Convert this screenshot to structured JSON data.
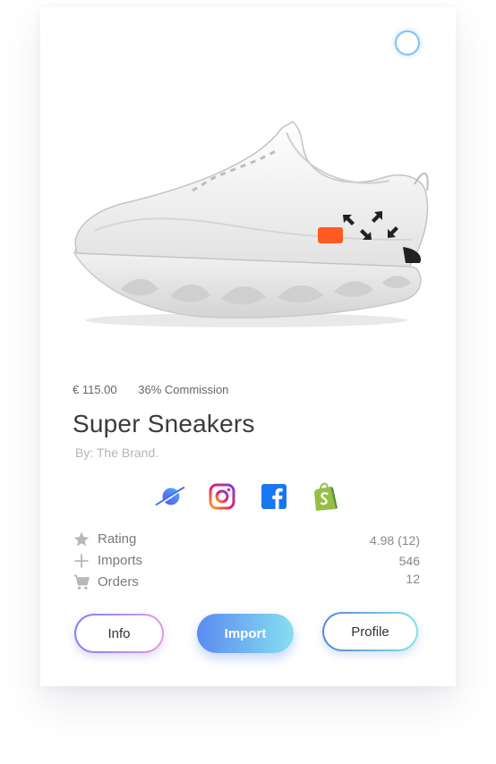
{
  "product": {
    "price": "€ 115.00",
    "commission": "36% Commission",
    "title": "Super Sneakers",
    "byline": "By: The Brand."
  },
  "socials": [
    {
      "name": "blue-planet-icon"
    },
    {
      "name": "instagram-icon"
    },
    {
      "name": "facebook-icon"
    },
    {
      "name": "shopify-icon"
    }
  ],
  "stats": {
    "rating": {
      "label": "Rating",
      "value": "4.98 (12)",
      "icon": "star-icon"
    },
    "imports": {
      "label": "Imports",
      "value": "546",
      "icon": "plus-icon"
    },
    "orders": {
      "label": "Orders",
      "value": "12",
      "icon": "cart-icon"
    }
  },
  "actions": {
    "info_label": "Info",
    "import_label": "Import",
    "profile_label": "Profile"
  },
  "colors": {
    "import_gradient_start": "#5b8bf0",
    "import_gradient_end": "#86dff1",
    "select_circle": "#7cc7ef",
    "title": "#3b3b3b"
  }
}
